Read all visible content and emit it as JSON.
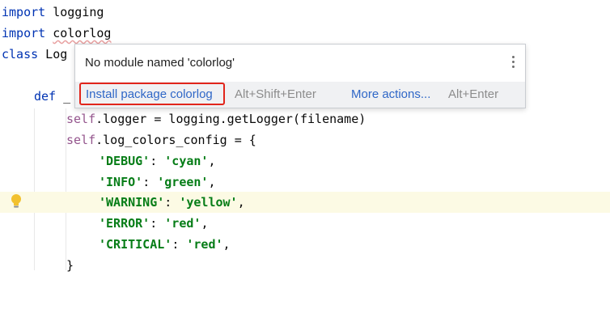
{
  "editor": {
    "lines": {
      "l1_kw": "import",
      "l1_mod": " logging",
      "l2_kw": "import",
      "l2_mod": "colorlog",
      "l3_kw": "class",
      "l3_name": " Log",
      "l5_kw": "def",
      "l5_rest": " _",
      "l6_self": "self",
      "l6_rest": ".logger = logging.getLogger(filename)",
      "l7_self": "self",
      "l7_rest": ".log_colors_config = {",
      "l8_key": "'DEBUG'",
      "l8_sep": ": ",
      "l8_val": "'cyan'",
      "l8_end": ",",
      "l9_key": "'INFO'",
      "l9_sep": ": ",
      "l9_val": "'green'",
      "l9_end": ",",
      "l10_key": "'WARNING'",
      "l10_sep": ": ",
      "l10_val": "'yellow'",
      "l10_end": ",",
      "l11_key": "'ERROR'",
      "l11_sep": ": ",
      "l11_val": "'red'",
      "l11_end": ",",
      "l12_key": "'CRITICAL'",
      "l12_sep": ": ",
      "l12_val": "'red'",
      "l12_end": ",",
      "l13": "}"
    },
    "gutter_icon": "lightbulb-icon"
  },
  "popup": {
    "title": "No module named 'colorlog'",
    "menu_icon": "kebab-menu-icon",
    "install_label": "Install package colorlog",
    "install_shortcut": "Alt+Shift+Enter",
    "more_label": "More actions...",
    "more_shortcut": "Alt+Enter"
  },
  "colors": {
    "keyword": "#0033b3",
    "self": "#94558d",
    "string": "#067d17",
    "highlight_box": "#e1251b",
    "link": "#2f67c7"
  }
}
